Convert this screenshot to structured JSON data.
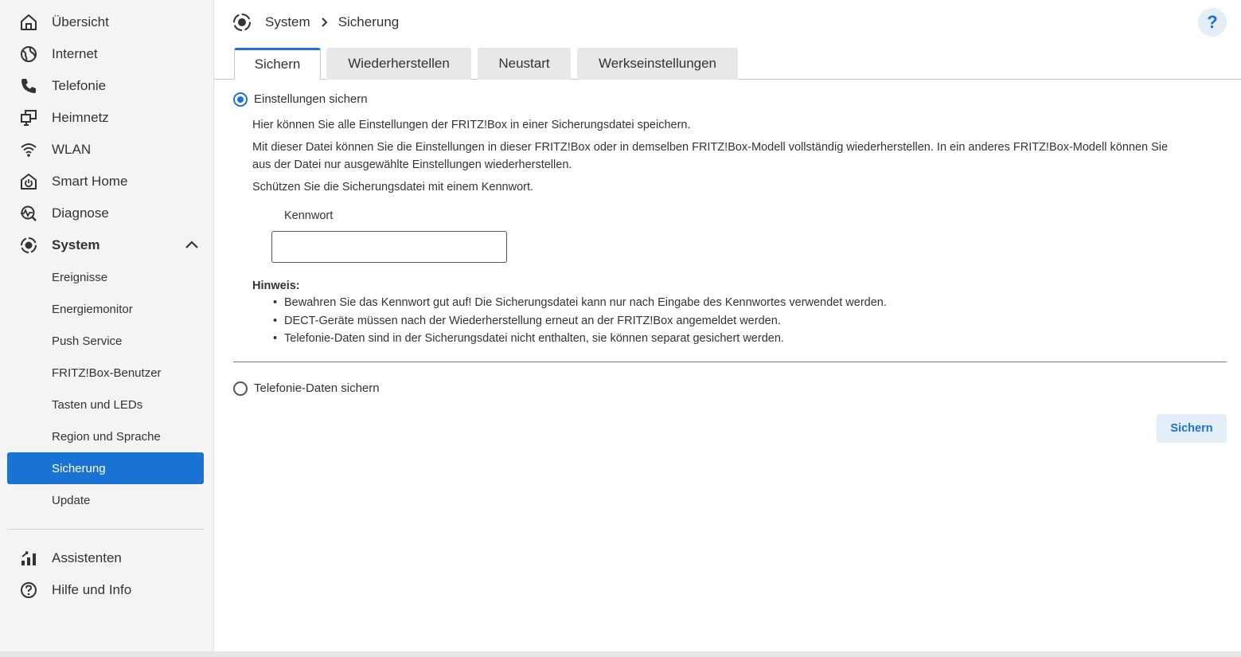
{
  "sidebar": {
    "items": [
      {
        "label": "Übersicht",
        "icon": "home-icon"
      },
      {
        "label": "Internet",
        "icon": "globe-icon"
      },
      {
        "label": "Telefonie",
        "icon": "phone-icon"
      },
      {
        "label": "Heimnetz",
        "icon": "network-icon"
      },
      {
        "label": "WLAN",
        "icon": "wifi-icon"
      },
      {
        "label": "Smart Home",
        "icon": "smart-home-icon"
      },
      {
        "label": "Diagnose",
        "icon": "diagnose-icon"
      },
      {
        "label": "System",
        "icon": "system-icon"
      }
    ],
    "system_sub": [
      "Ereignisse",
      "Energiemonitor",
      "Push Service",
      "FRITZ!Box-Benutzer",
      "Tasten und LEDs",
      "Region und Sprache",
      "Sicherung",
      "Update"
    ],
    "bottom": [
      {
        "label": "Assistenten",
        "icon": "assistant-icon"
      },
      {
        "label": "Hilfe und Info",
        "icon": "help-circle-icon"
      }
    ]
  },
  "header": {
    "breadcrumb": [
      "System",
      "Sicherung"
    ],
    "help": "?"
  },
  "tabs": [
    "Sichern",
    "Wiederherstellen",
    "Neustart",
    "Werkseinstellungen"
  ],
  "content": {
    "option1_label": "Einstellungen sichern",
    "para1": "Hier können Sie alle Einstellungen der FRITZ!Box in einer Sicherungsdatei speichern.",
    "para2_line1": "Mit dieser Datei können Sie die Einstellungen in dieser FRITZ!Box oder in demselben FRITZ!Box-Modell vollständig wiederherstellen. In ein anderes FRITZ!Box-Modell können Sie",
    "para2_line2": "aus der Datei nur ausgewählte Einstellungen wiederherstellen.",
    "para3": "Schützen Sie die Sicherungsdatei mit einem Kennwort.",
    "password_label": "Kennwort",
    "password_value": "",
    "hint_title": "Hinweis:",
    "hints": [
      "Bewahren Sie das Kennwort gut auf! Die Sicherungsdatei kann nur nach Eingabe des Kennwortes verwendet werden.",
      "DECT-Geräte müssen nach der Wiederherstellung erneut an der FRITZ!Box angemeldet werden.",
      "Telefonie-Daten sind in der Sicherungsdatei nicht enthalten, sie können separat gesichert werden."
    ],
    "option2_label": "Telefonie-Daten sichern",
    "save_button": "Sichern"
  },
  "colors": {
    "accent": "#1a73d2",
    "sidebar_bg": "#f4f4f4",
    "button_bg": "#e4eef8"
  }
}
